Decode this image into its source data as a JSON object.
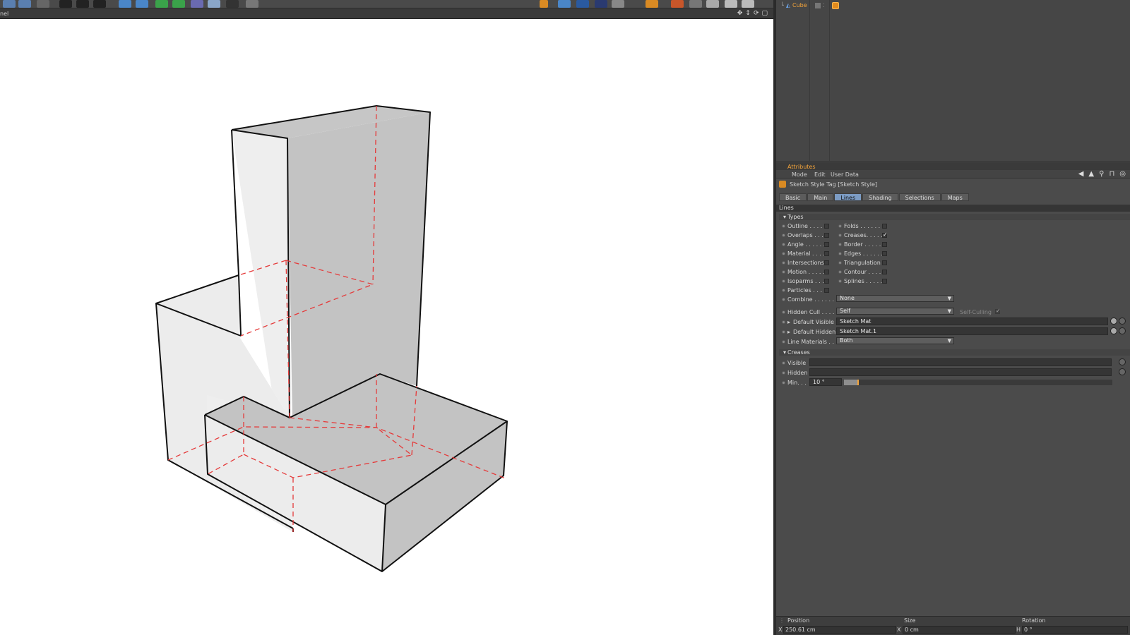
{
  "viewport": {
    "label": "nel"
  },
  "object_manager": {
    "object_name": "Cube"
  },
  "attributes": {
    "title": "Attributes",
    "menu": [
      "Mode",
      "Edit",
      "User Data"
    ],
    "tag_title": "Sketch Style Tag [Sketch Style]",
    "tabs": [
      "Basic",
      "Main",
      "Lines",
      "Shading",
      "Selections",
      "Maps"
    ],
    "active_tab": "Lines",
    "section": "Lines",
    "types_group": "Types",
    "types_left": [
      {
        "label": "Outline . . . .",
        "checked": false
      },
      {
        "label": "Overlaps . . .",
        "checked": false
      },
      {
        "label": "Angle . . . . . .",
        "checked": false
      },
      {
        "label": "Material . . . .",
        "checked": false
      },
      {
        "label": "Intersections",
        "checked": false
      },
      {
        "label": "Motion . . . . .",
        "checked": false
      },
      {
        "label": "Isoparms . . .",
        "checked": false
      },
      {
        "label": "Particles . . . .",
        "checked": false
      }
    ],
    "types_right": [
      {
        "label": "Folds . . . . . .",
        "checked": false
      },
      {
        "label": "Creases. . . . .",
        "checked": true
      },
      {
        "label": "Border . . . . .",
        "checked": false
      },
      {
        "label": "Edges . . . . . .",
        "checked": false
      },
      {
        "label": "Triangulation",
        "checked": false
      },
      {
        "label": "Contour . . . .",
        "checked": false
      },
      {
        "label": "Splines . . . . .",
        "checked": false
      }
    ],
    "combine_label": "Combine . . . . . . . .",
    "combine_value": "None",
    "hidden_cull_label": "Hidden Cull . . . .",
    "hidden_cull_value": "Self",
    "self_culling_label": "Self-Culling",
    "default_visible_label": "Default Visible",
    "default_visible_value": "Sketch Mat",
    "default_hidden_label": "Default Hidden",
    "default_hidden_value": "Sketch Mat.1",
    "line_materials_label": "Line Materials . . .",
    "line_materials_value": "Both",
    "creases_group": "Creases",
    "creases_visible_label": "Visible",
    "creases_hidden_label": "Hidden",
    "creases_min_label": "Min. . .",
    "creases_min_value": "10 °",
    "creases_min_slider_fraction": 0.05
  },
  "coordinates": {
    "position_header": "Position",
    "size_header": "Size",
    "rotation_header": "Rotation",
    "position_x": "250.61 cm",
    "size_x": "0 cm",
    "rotation_h": "0 °",
    "axis_x": "X",
    "axis_x2": "X",
    "axis_h": "H"
  },
  "colors": {
    "accent": "#f2a33a",
    "tab_active": "#7c9cc4",
    "hidden_lines": "#e53a3a",
    "face_light": "#efefef",
    "face_dark": "#c3c3c3"
  }
}
